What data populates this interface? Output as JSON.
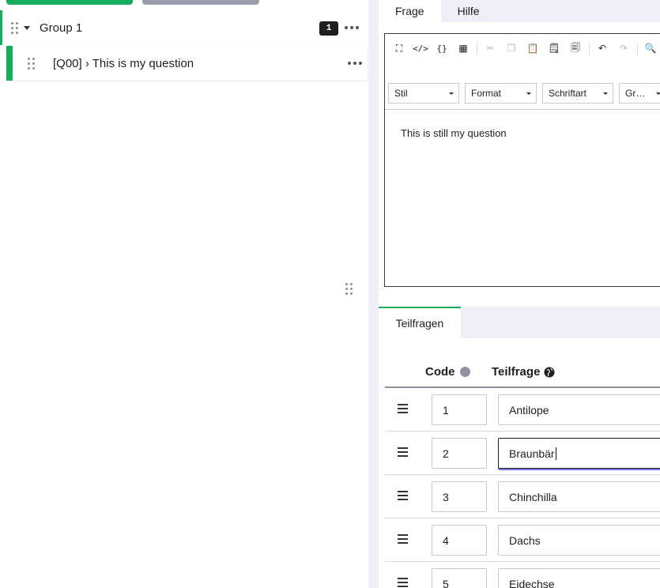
{
  "structure": {
    "group": {
      "title": "Group 1",
      "question_count": "1"
    },
    "question": {
      "title": "[Q00] › This is my question"
    }
  },
  "tabs": [
    {
      "label": "Frage",
      "active": true
    },
    {
      "label": "Hilfe",
      "active": false
    }
  ],
  "editor": {
    "toolbar_icons": [
      "maximize-icon",
      "source-icon",
      "code-braces-icon",
      "table-icon",
      "cut-icon",
      "copy-icon",
      "paste-icon",
      "paste-text-icon",
      "paste-word-icon",
      "undo-icon",
      "redo-icon",
      "search-icon"
    ],
    "combos": [
      "Stil",
      "Format",
      "Schriftart",
      "Gr…"
    ],
    "content": "This is still my question"
  },
  "subtab": {
    "label": "Teilfragen"
  },
  "table": {
    "headers": {
      "code": "Code",
      "text": "Teilfrage"
    },
    "rows": [
      {
        "code": "1",
        "text": "Antilope"
      },
      {
        "code": "2",
        "text": "Braunbär"
      },
      {
        "code": "3",
        "text": "Chinchilla"
      },
      {
        "code": "4",
        "text": "Dachs"
      },
      {
        "code": "5",
        "text": "Eidechse"
      }
    ]
  },
  "colors": {
    "accent": "#14ae5c",
    "panel_bg": "#eeeff7",
    "muted": "#8f93a1",
    "focus": "#7a78e8"
  }
}
